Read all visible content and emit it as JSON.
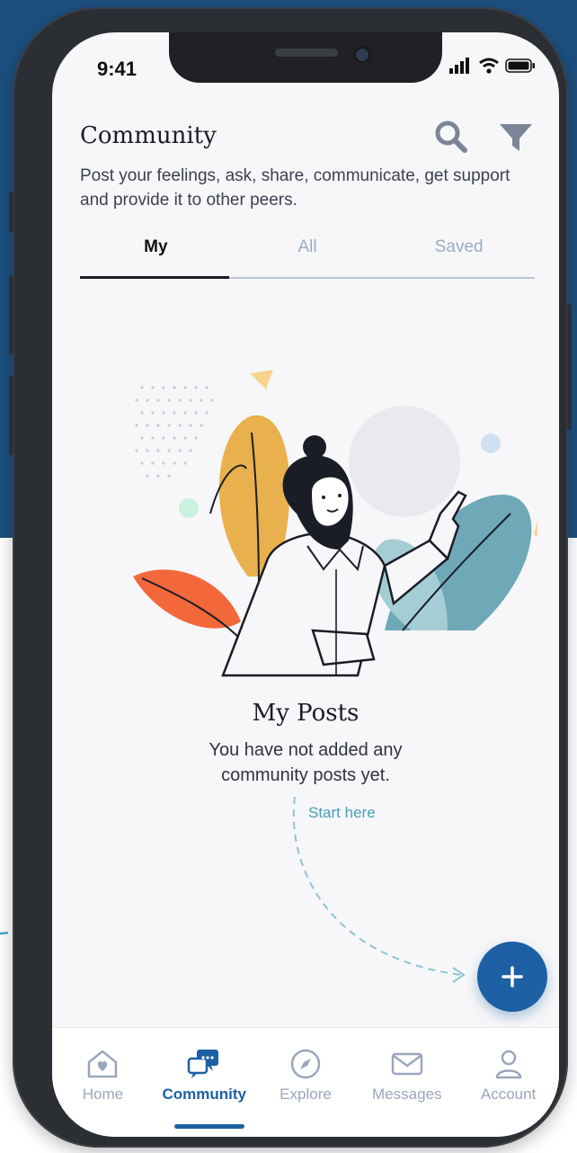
{
  "status": {
    "time": "9:41"
  },
  "header": {
    "title": "Community",
    "subtitle": "Post your feelings, ask, share, communicate, get support and provide it to other peers.",
    "icons": [
      "search-icon",
      "filter-icon"
    ]
  },
  "tabs": [
    {
      "label": "My",
      "active": true
    },
    {
      "label": "All",
      "active": false
    },
    {
      "label": "Saved",
      "active": false
    }
  ],
  "empty_state": {
    "title": "My Posts",
    "message": "You have not added any community posts yet.",
    "hint": "Start here"
  },
  "fab": {
    "icon": "plus-icon"
  },
  "bottom_nav": [
    {
      "label": "Home",
      "icon": "home-heart-icon",
      "active": false
    },
    {
      "label": "Community",
      "icon": "chat-bubbles-icon",
      "active": true
    },
    {
      "label": "Explore",
      "icon": "compass-icon",
      "active": false
    },
    {
      "label": "Messages",
      "icon": "envelope-icon",
      "active": false
    },
    {
      "label": "Account",
      "icon": "user-icon",
      "active": false
    }
  ],
  "colors": {
    "background_brand": "#1d4f7e",
    "accent": "#1d60a3",
    "inactive": "#9aa6bb",
    "hint": "#4a9cb8"
  }
}
